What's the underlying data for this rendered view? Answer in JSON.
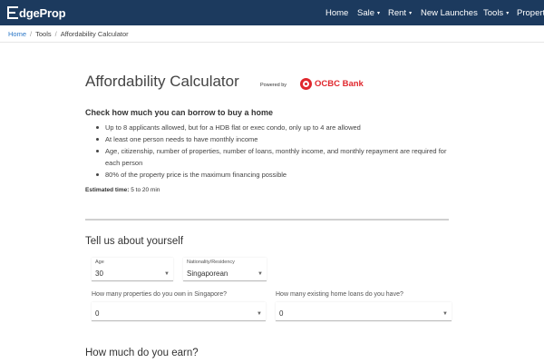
{
  "header": {
    "logo_text": "dgeProp",
    "nav": [
      {
        "label": "Home",
        "dropdown": false
      },
      {
        "label": "Sale",
        "dropdown": true
      },
      {
        "label": "Rent",
        "dropdown": true
      },
      {
        "label": "New Launches",
        "dropdown": false
      },
      {
        "label": "Tools",
        "dropdown": true
      },
      {
        "label": "Propert",
        "dropdown": false
      }
    ],
    "bg_color": "#1c3a5e"
  },
  "breadcrumb": {
    "items": [
      "Home",
      "Tools",
      "Affordability Calculator"
    ],
    "separator": "/"
  },
  "page": {
    "title": "Affordability Calculator",
    "powered_by": "Powered by",
    "partner": "OCBC Bank",
    "partner_color": "#e0282e"
  },
  "intro": {
    "heading": "Check how much you can borrow to buy a home",
    "bullets": [
      "Up to 8 applicants allowed, but for a HDB flat or exec condo, only up to 4 are allowed",
      "At least one person needs to have monthly income",
      "Age, citizenship, number of properties, number of loans, monthly income, and monthly repayment are required for each person",
      "80% of the property price is the maximum financing possible"
    ],
    "estimated_label": "Estimated time:",
    "estimated_value": "5 to 20 min"
  },
  "about": {
    "heading": "Tell us about yourself",
    "age": {
      "label": "Age",
      "value": "30"
    },
    "nationality": {
      "label": "Nationality/Residency",
      "value": "Singaporean"
    },
    "properties": {
      "question": "How many properties do you own in Singapore?",
      "value": "0"
    },
    "loans": {
      "question": "How many existing home loans do you have?",
      "value": "0"
    }
  },
  "earn": {
    "heading": "How much do you earn?"
  }
}
